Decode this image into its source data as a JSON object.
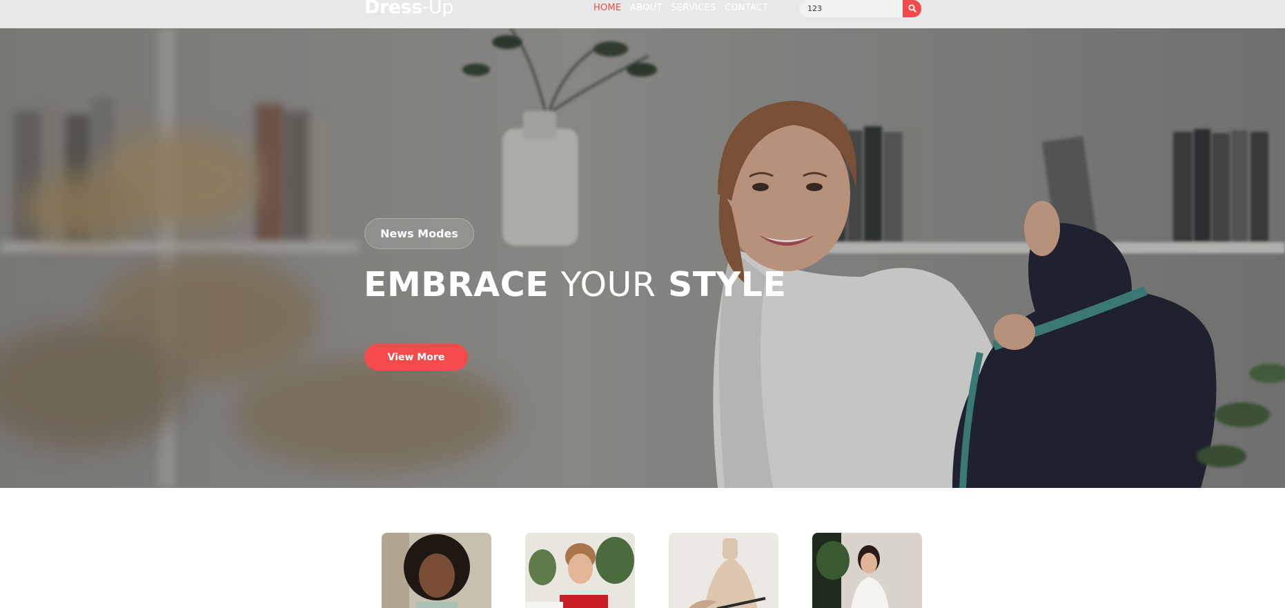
{
  "navbar": {
    "logo": {
      "part1": "Dress",
      "part2": "-Up"
    },
    "menu": [
      {
        "label": "HOME",
        "active": true
      },
      {
        "label": "ABOUT",
        "active": false
      },
      {
        "label": "SERVICES",
        "active": false
      },
      {
        "label": "CONTACT",
        "active": false
      }
    ],
    "search": {
      "value": "123",
      "icon": "search-icon"
    }
  },
  "hero": {
    "badge": "News Modes",
    "title": {
      "word1": "EMBRACE",
      "word2": "YOUR",
      "word3": "STYLE"
    },
    "button": "View More"
  },
  "cards": [
    {
      "image": "woman-curly-hair-photo"
    },
    {
      "image": "woman-sewing-photo"
    },
    {
      "image": "mannequin-tailoring-photo"
    },
    {
      "image": "woman-designer-photo"
    }
  ],
  "colors": {
    "accent": "#f24a4b",
    "navbar_bg": "#e7e8e8",
    "text_light": "#ffffff"
  }
}
